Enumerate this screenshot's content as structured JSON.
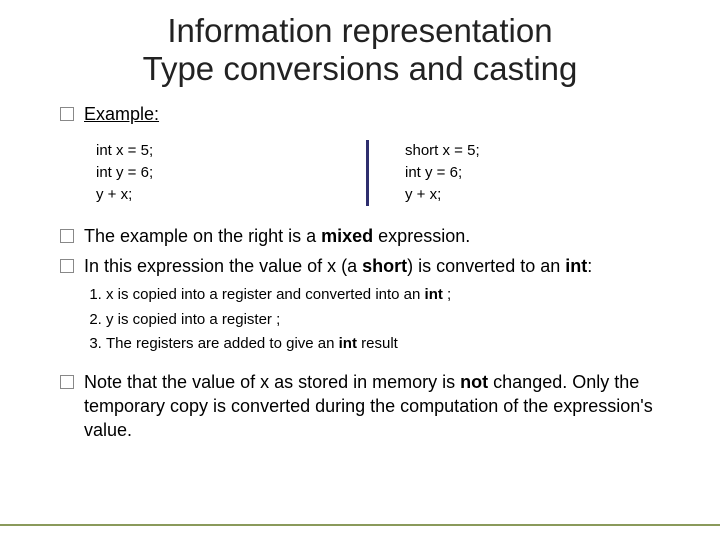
{
  "title_line1": "Information representation",
  "title_line2": "Type conversions and casting",
  "example_label": "Example:",
  "code_left": {
    "l1": "int x = 5;",
    "l2": "int y = 6;",
    "l3": "y + x;"
  },
  "code_right": {
    "l1": "short x = 5;",
    "l2": "int y = 6;",
    "l3": "y + x;"
  },
  "para1_a": "The example on the right is a ",
  "para1_b": "mixed",
  "para1_c": " expression.",
  "para2_a": "In this expression the value of x (a ",
  "para2_b": "short",
  "para2_c": ") is converted to an ",
  "para2_d": "int",
  "para2_e": ":",
  "step1_a": "x is copied into a register and converted into an ",
  "step1_b": "int",
  "step1_c": " ;",
  "step2": "y is copied into a register ;",
  "step3_a": "The registers are added to give an ",
  "step3_b": "int",
  "step3_c": " result",
  "note_a": "Note that the value of x as stored in memory is ",
  "note_b": "not",
  "note_c": " changed. Only the temporary copy is converted during the computation of the expression's value."
}
